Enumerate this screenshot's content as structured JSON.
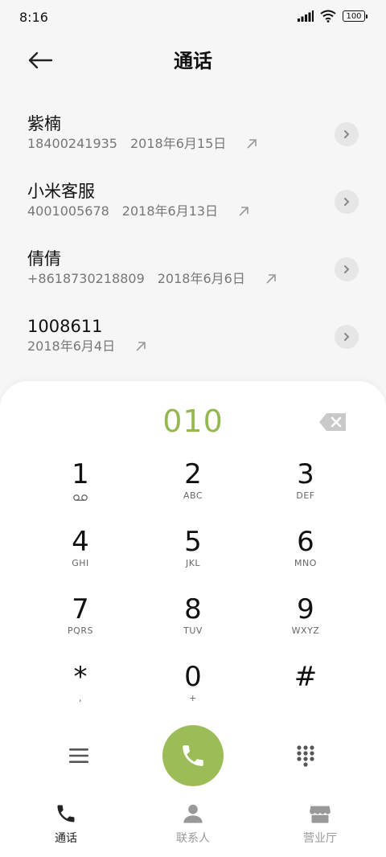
{
  "status_bar": {
    "time": "8:16",
    "battery": "100"
  },
  "header": {
    "title": "通话"
  },
  "calls": [
    {
      "name": "紫楠",
      "number": "18400241935",
      "date": "2018年6月15日"
    },
    {
      "name": "小米客服",
      "number": "4001005678",
      "date": "2018年6月13日"
    },
    {
      "name": "倩倩",
      "number": "+8618730218809",
      "date": "2018年6月6日"
    },
    {
      "name": "1008611",
      "number": "",
      "date": "2018年6月4日"
    }
  ],
  "dialpad": {
    "input": "010",
    "keys": [
      {
        "digit": "1",
        "letters": ""
      },
      {
        "digit": "2",
        "letters": "ABC"
      },
      {
        "digit": "3",
        "letters": "DEF"
      },
      {
        "digit": "4",
        "letters": "GHI"
      },
      {
        "digit": "5",
        "letters": "JKL"
      },
      {
        "digit": "6",
        "letters": "MNO"
      },
      {
        "digit": "7",
        "letters": "PQRS"
      },
      {
        "digit": "8",
        "letters": "TUV"
      },
      {
        "digit": "9",
        "letters": "WXYZ"
      },
      {
        "digit": "*",
        "letters": ","
      },
      {
        "digit": "0",
        "letters": "+"
      },
      {
        "digit": "#",
        "letters": ""
      }
    ]
  },
  "nav": {
    "calls": "通话",
    "contacts": "联系人",
    "business_hall": "营业厅"
  },
  "colors": {
    "accent": "#9cbc57",
    "input_text": "#94b84f"
  }
}
